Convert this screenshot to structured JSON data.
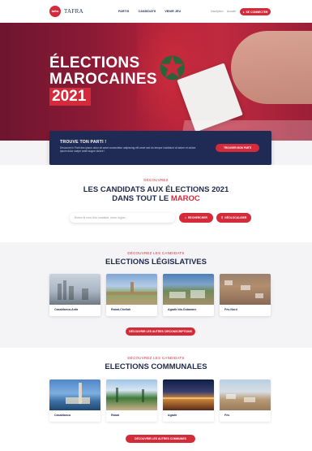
{
  "header": {
    "logo_badge": "tafra",
    "logo_text": "TAFRA",
    "nav": [
      "PARTIS",
      "CANDIDATS",
      "VENIR JEU"
    ],
    "link_register": "Inscription",
    "link_login": "Accueil",
    "signin_label": "SE CONNECTER"
  },
  "hero": {
    "title_line1": "ÉLECTIONS",
    "title_line2": "MAROCAINES",
    "year": "2021"
  },
  "party_card": {
    "title": "TROUVE TON PARTI !",
    "text": "Découvre le Parti des ipsum dolor sit amet consectetur adipiscing elit amet sed do tempor incididunt ut labore et dolore ipsum dolor saepe amet augue dolore !",
    "button": "TROUVER MON PARTI"
  },
  "candidates": {
    "kicker": "DÉCOUVREZ",
    "title_line1": "LES CANDIDATS AUX ÉLECTIONS 2021",
    "title_line2_prefix": "DANS TOUT LE ",
    "title_line2_accent": "MAROC",
    "search_placeholder": "Entrez le nom d'un candidat, d'une région...",
    "search_button": "RECHERCHER",
    "geo_button": "GÉOLOCALISER"
  },
  "legislatives": {
    "kicker": "DÉCOUVREZ LES CANDIDATS",
    "title": "ELECTIONS LÉGISLATIVES",
    "cards": [
      "Casablanca-Anfa",
      "Rabat-Chellah",
      "Agadir Ida-Outanane",
      "Fès-Nord"
    ],
    "button": "DÉCOUVRIR LES AUTRES CIRCONSCRIPTIONS"
  },
  "communales": {
    "kicker": "DÉCOUVREZ LES CANDIDATS",
    "title": "ELECTIONS COMMUNALES",
    "cards": [
      "Casablanca",
      "Rabat",
      "Agadir",
      "Fès"
    ],
    "button": "DÉCOUVRIR LES AUTRES COMMUNES"
  },
  "colors": {
    "accent": "#d42b3a",
    "navy": "#1f2a55",
    "text": "#1f2a4a"
  }
}
